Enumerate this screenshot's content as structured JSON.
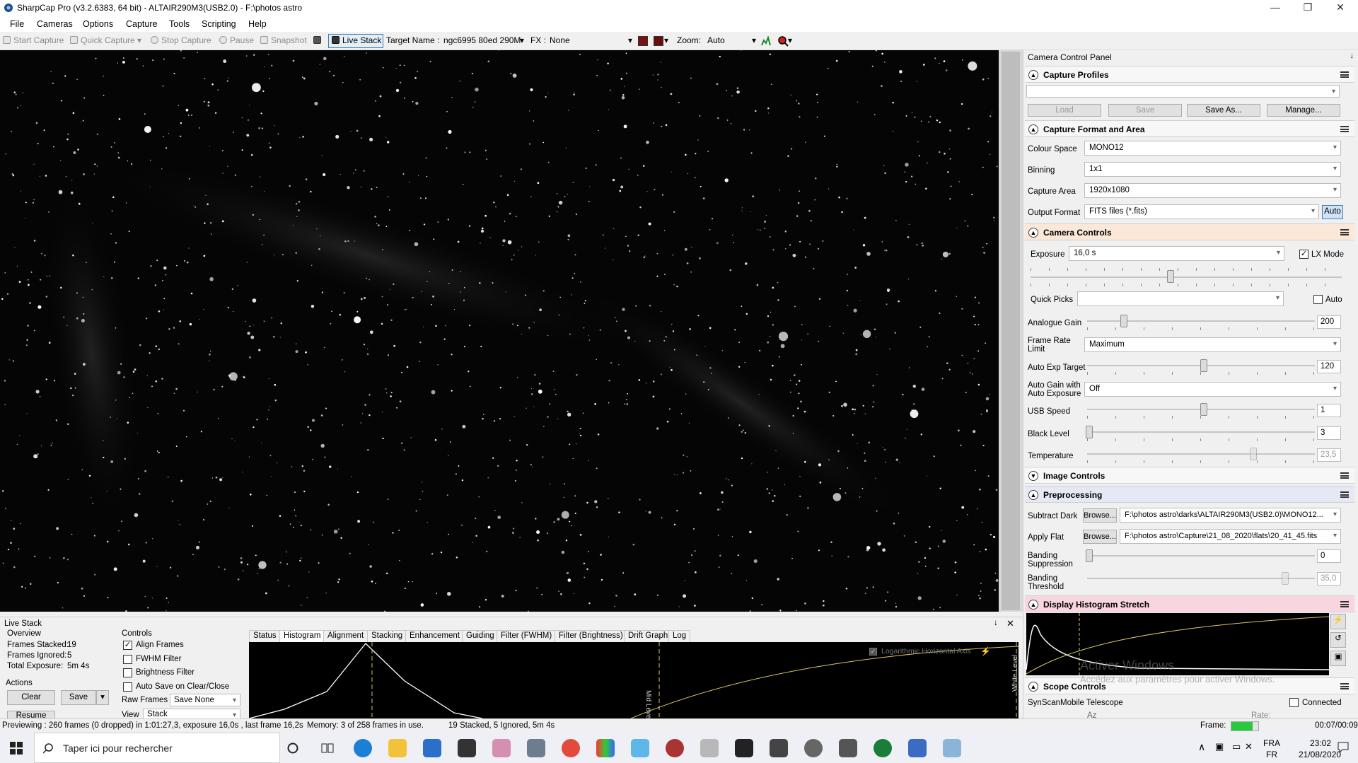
{
  "window": {
    "title": "SharpCap Pro (v3.2.6383, 64 bit) - ALTAIR290M3(USB2.0) - F:\\photos astro"
  },
  "menu": [
    "File",
    "Cameras",
    "Options",
    "Capture",
    "Tools",
    "Scripting",
    "Help"
  ],
  "toolbar": {
    "start_capture": "Start Capture",
    "quick_capture": "Quick Capture",
    "stop_capture": "Stop Capture",
    "pause": "Pause",
    "snapshot": "Snapshot",
    "live_stack": "Live Stack",
    "target_label": "Target Name :",
    "target_value": "ngc6995 80ed 290M",
    "fx_label": "FX :",
    "fx_value": "None",
    "zoom_label": "Zoom:",
    "zoom_value": "Auto"
  },
  "panel": {
    "title": "Camera Control Panel",
    "capture_profiles": {
      "header": "Capture Profiles",
      "profile_value": "",
      "load": "Load",
      "save": "Save",
      "save_as": "Save As...",
      "manage": "Manage..."
    },
    "capture_format": {
      "header": "Capture Format and Area",
      "colour_space_label": "Colour Space",
      "colour_space": "MONO12",
      "binning_label": "Binning",
      "binning": "1x1",
      "capture_area_label": "Capture Area",
      "capture_area": "1920x1080",
      "output_format_label": "Output Format",
      "output_format": "FITS files (*.fits)",
      "auto": "Auto"
    },
    "camera_controls": {
      "header": "Camera Controls",
      "exposure_label": "Exposure",
      "exposure": "16,0 s",
      "lx_mode": "LX Mode",
      "quick_picks_label": "Quick Picks",
      "quick_picks": "",
      "auto": "Auto",
      "analogue_gain_label": "Analogue Gain",
      "analogue_gain": "200",
      "frame_rate_label_1": "Frame Rate",
      "frame_rate_label_2": "Limit",
      "frame_rate": "Maximum",
      "auto_exp_target_label": "Auto Exp Target",
      "auto_exp_target": "120",
      "auto_gain_label_1": "Auto Gain with",
      "auto_gain_label_2": "Auto Exposure",
      "auto_gain": "Off",
      "usb_speed_label": "USB Speed",
      "usb_speed": "1",
      "black_level_label": "Black Level",
      "black_level": "3",
      "temperature_label": "Temperature",
      "temperature": "23,5"
    },
    "image_controls": {
      "header": "Image Controls"
    },
    "preprocessing": {
      "header": "Preprocessing",
      "subtract_dark_label": "Subtract Dark",
      "subtract_dark": "F:\\photos astro\\darks\\ALTAIR290M3(USB2.0)\\MONO12...",
      "apply_flat_label": "Apply Flat",
      "apply_flat": "F:\\photos astro\\Capture\\21_08_2020\\flats\\20_41_45.fits",
      "browse": "Browse...",
      "banding_supp_label_1": "Banding",
      "banding_supp_label_2": "Suppression",
      "banding_supp": "0",
      "banding_thr_label_1": "Banding",
      "banding_thr_label_2": "Threshold",
      "banding_thr": "35,0"
    },
    "histogram_stretch": {
      "header": "Display Histogram Stretch"
    },
    "scope_controls": {
      "header": "Scope Controls",
      "telescope": "SynScanMobile Telescope",
      "connected": "Connected",
      "az": "Az",
      "rate": "Rate:"
    },
    "watermark_1": "Activer Windows",
    "watermark_2": "Accédez aux paramètres pour activer Windows."
  },
  "livestack": {
    "title": "Live Stack",
    "overview": "Overview",
    "frames_stacked_label": "Frames Stacked:",
    "frames_stacked": "19",
    "frames_ignored_label": "Frames Ignored:",
    "frames_ignored": "5",
    "total_exposure_label": "Total Exposure:",
    "total_exposure": "5m 4s",
    "actions": "Actions",
    "clear": "Clear",
    "save": "Save",
    "resume": "Resume",
    "controls": "Controls",
    "align_frames": "Align Frames",
    "fwhm_filter": "FWHM Filter",
    "brightness_filter": "Brightness Filter",
    "auto_save": "Auto Save on Clear/Close",
    "raw_frames_label": "Raw Frames",
    "raw_frames": "Save None",
    "view_label": "View",
    "view": "Stack",
    "tabs": [
      "Status",
      "Histogram",
      "Alignment",
      "Stacking",
      "Enhancement",
      "Guiding",
      "Filter (FWHM)",
      "Filter (Brightness)",
      "Drift Graph",
      "Log"
    ],
    "log_axis": "Logarithmic Horizontal Axis",
    "mid_level": "Mid Level",
    "white_level": "White Level"
  },
  "status": {
    "preview": "Previewing : 260 frames (0 dropped) in 1:01:27,3, exposure 16,0s , last frame 16,2s",
    "memory": "Memory: 3 of 258 frames in use.",
    "stack": "19 Stacked, 5 Ignored, 5m 4s",
    "frame_label": "Frame:",
    "time": "00:07/00:09"
  },
  "taskbar": {
    "search": "Taper ici pour rechercher",
    "lang_1": "FRA",
    "lang_2": "FR",
    "time": "23:02",
    "date": "21/08/2020"
  }
}
